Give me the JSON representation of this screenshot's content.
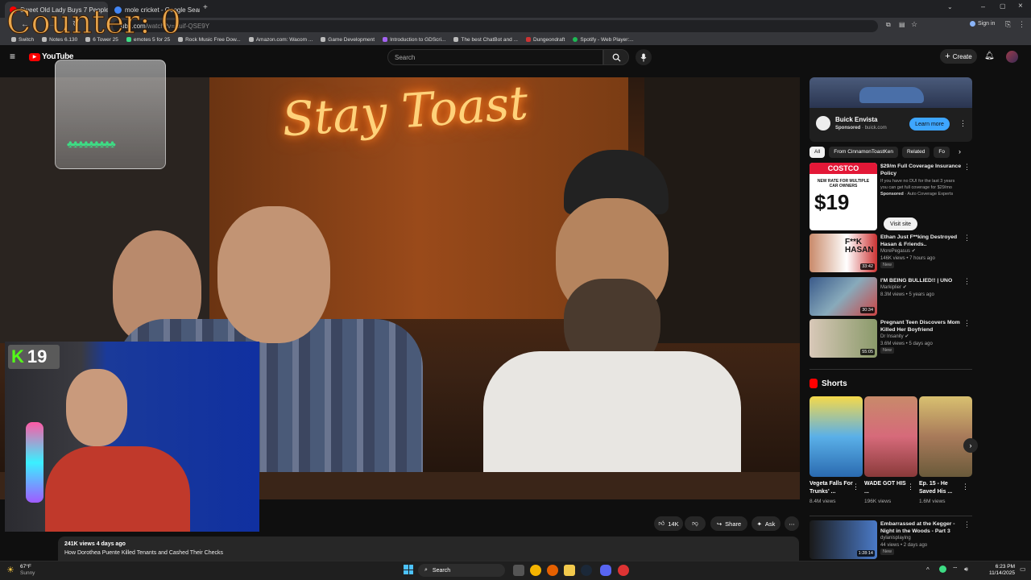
{
  "browser": {
    "tabs": [
      {
        "title": "Sweet Old Lady Buys 7 People",
        "active": true
      },
      {
        "title": "mole cricket - Google Search",
        "active": false
      }
    ],
    "url_prefix": "ube.com",
    "url_rest": "/watch?v=Xuif-QSE9Y",
    "sign_in": "Sign in",
    "bookmarks": [
      "Switch",
      "Notes 6.130",
      "6 Tower 25",
      "emotes 5 for 25",
      "Rock Music Free Dow...",
      "Amazon.com: Wacom ...",
      "Game Development",
      "Introduction to GDScri...",
      "The best ChatBot and ...",
      "Dungeondraft",
      "Spotify - Web Player:..."
    ]
  },
  "overlay": {
    "counter_label": "Counter: 0",
    "webcam_badge_count": "19"
  },
  "youtube": {
    "logo": "YouTube",
    "search_placeholder": "Search",
    "create_label": "Create"
  },
  "video": {
    "neon_sign": "Stay Toast",
    "views_line": "241K views  4 days ago",
    "description_title": "How Dorothea Puente Killed Tenants and Cashed Their Checks",
    "likes": "14K",
    "share_label": "Share",
    "ask_label": "Ask"
  },
  "ad": {
    "name": "Buick Envista",
    "sponsored": "Sponsored",
    "domain": "buick.com",
    "cta": "Learn more"
  },
  "filters": [
    "All",
    "From CinnamonToastKen",
    "Related",
    "Fo"
  ],
  "sponsored_rec": {
    "title": "$29/m Full Coverage Insurance Policy",
    "desc": "If you have no DUI for the last 3 years you can get full coverage for $29/mo",
    "sponsored": "Sponsored",
    "advertiser": "Auto Coverage Experts",
    "cta": "Visit site",
    "thumb_brand": "COSTCO",
    "thumb_line1": "NEW RATE FOR MULTIPLE",
    "thumb_line2": "CAR OWNERS",
    "thumb_price": "$19"
  },
  "recommendations": [
    {
      "title": "Ethan Just F**king Destroyed Hasan & Friends..",
      "channel": "MorePegasus",
      "meta": "146K views • 7 hours ago",
      "badge": "New",
      "duration": "33:42",
      "thumb_text": "F**K HASAN"
    },
    {
      "title": "I'M BEING BULLIED!! | UNO",
      "channel": "Markiplier",
      "meta": "8.3M views • 5 years ago",
      "badge": "",
      "duration": "30:34",
      "thumb_text": ""
    },
    {
      "title": "Pregnant Teen Discovers Mom Killed Her Boyfriend",
      "channel": "Dr Insanity",
      "meta": "3.6M views • 5 days ago",
      "badge": "New",
      "duration": "55:05",
      "thumb_text": ""
    }
  ],
  "shorts": {
    "heading": "Shorts",
    "items": [
      {
        "title": "Vegeta Falls For Trunks' ...",
        "views": "8.4M views"
      },
      {
        "title": "WADE GOT HIS ...",
        "views": "196K views"
      },
      {
        "title": "Ep. 15 - He Saved His ...",
        "views": "1.6M views"
      }
    ]
  },
  "bottom_rec": {
    "title": "Embarrassed at the Kegger - Night in the Woods - Part 3",
    "channel": "dylanisplaying",
    "meta": "44 views • 2 days ago",
    "badge": "New",
    "duration": "1:28:14"
  },
  "taskbar": {
    "weather_temp": "67°F",
    "weather_desc": "Sunny",
    "search_label": "Search",
    "time": "6:23 PM",
    "date": "11/14/2025"
  },
  "colors": {
    "yt_red": "#ff0000",
    "accent_blue": "#3ea6ff",
    "neon": "#ffb347"
  }
}
